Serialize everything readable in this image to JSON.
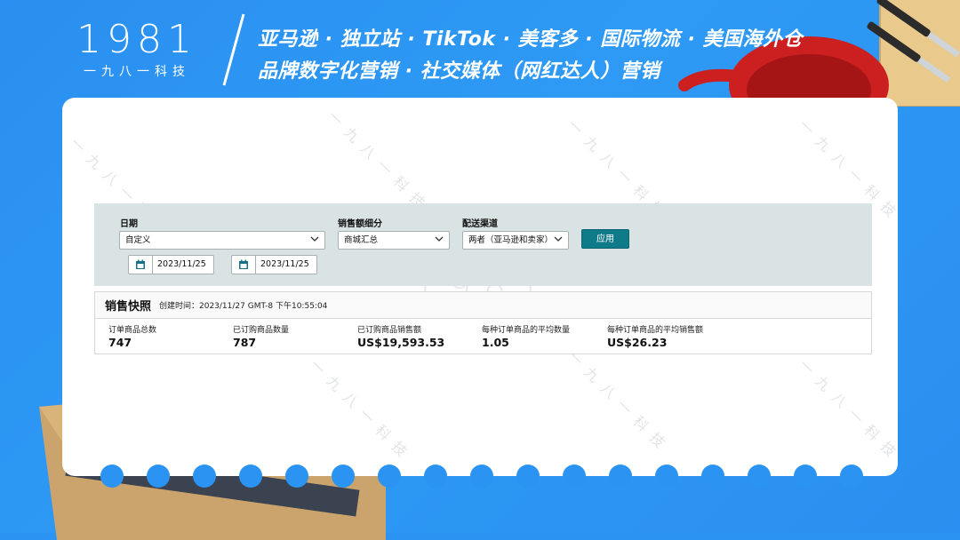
{
  "header": {
    "logo_number": "1981",
    "logo_sub": "一九八一科技",
    "tagline_line1": "亚马逊 · 独立站 · TikTok · 美客多 · 国际物流 · 美国海外仓",
    "tagline_line2": "品牌数字化营销 · 社交媒体（网红达人）营销"
  },
  "watermark": {
    "text": "一九八一科技",
    "logo": "1981"
  },
  "filters": {
    "date_label": "日期",
    "date_range_value": "自定义",
    "start_date": "2023/11/25",
    "end_date": "2023/11/25",
    "sales_breakdown_label": "销售额细分",
    "sales_breakdown_value": "商城汇总",
    "fulfillment_label": "配送渠道",
    "fulfillment_value": "两者（亚马逊和卖家）",
    "apply_label": "应用"
  },
  "snapshot": {
    "title": "销售快照",
    "created_time": "创建时间：2023/11/27 GMT-8 下午10:55:04",
    "metrics": [
      {
        "label": "订单商品总数",
        "value": "747"
      },
      {
        "label": "已订购商品数量",
        "value": "787"
      },
      {
        "label": "已订购商品销售额",
        "value": "US$19,593.53"
      },
      {
        "label": "每种订单商品的平均数量",
        "value": "1.05"
      },
      {
        "label": "每种订单商品的平均销售额",
        "value": "US$26.23"
      }
    ]
  },
  "colors": {
    "background": "#2b94f2",
    "filter_panel": "#d9e3e4",
    "apply_button": "#0f7a88",
    "pan_red": "#cc1f1f"
  },
  "icons": {
    "calendar": "calendar-icon",
    "dropdown": "chevron-down-icon"
  }
}
